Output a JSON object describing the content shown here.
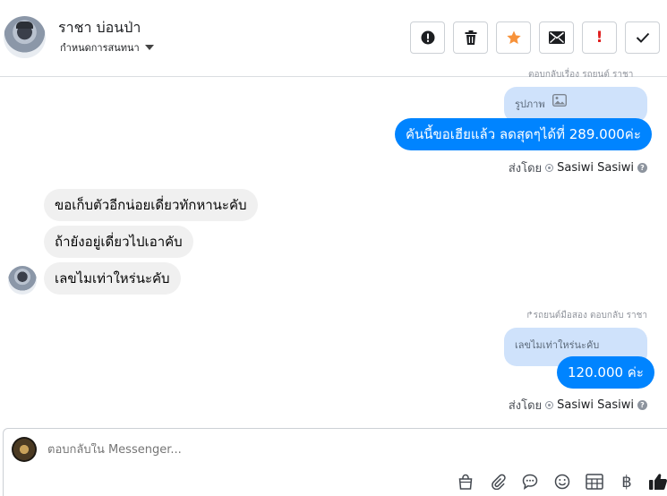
{
  "header": {
    "contact_name": "ราชา บ่อนป่า",
    "subtitle": "กำหนดการสนทนา",
    "actions": [
      {
        "name": "report-icon",
        "color": "#1c1e21"
      },
      {
        "name": "trash-icon",
        "color": "#1c1e21"
      },
      {
        "name": "star-icon",
        "color": "#f7923a"
      },
      {
        "name": "mail-icon",
        "color": "#1c1e21"
      },
      {
        "name": "exclamation-icon",
        "color": "#e02020"
      },
      {
        "name": "check-icon",
        "color": "#1c1e21"
      }
    ],
    "exclamation_label": "!"
  },
  "messages": {
    "top_partial_note": "ตอบกลับเรื่อง  รถยนต์  ราชา",
    "quoted_photo_label": "รูปภาพ",
    "offer_text": "คันนี้ขอเฮียแล้ว ลดสุดๆได้ที่ 289.000ค่ะ",
    "sent_by_label_1": "ส่งโดย",
    "sent_by_name_1": "Sasiwi Sasiwi",
    "incoming": [
      "ขอเก็บตัวอีกน่อยเดี่ยวทักหานะคับ",
      "ถ้ายังอยู่เดี่ยวไปเอาคับ",
      "เลขไมเท่าใหร่นะคับ"
    ],
    "reply_note": "รถยนต์มือสอง ตอบกลับ ราชา",
    "quoted_text": "เลขไมเท่าใหร่นะคับ",
    "mileage_text": "120.000 ค่ะ",
    "sent_by_label_2": "ส่งโดย",
    "sent_by_name_2": "Sasiwi Sasiwi",
    "help_glyph": "?"
  },
  "composer": {
    "placeholder": "ตอบกลับใน Messenger...",
    "tools": [
      "shopping-bag-icon",
      "paperclip-icon",
      "saved-reply-icon",
      "emoji-icon",
      "table-icon",
      "baht-icon",
      "like-icon"
    ],
    "baht_glyph": "฿"
  },
  "colors": {
    "outgoing_bubble": "#0084ff",
    "incoming_bubble": "#f0f0f0",
    "quoted_bubble": "#cfe2fb"
  }
}
